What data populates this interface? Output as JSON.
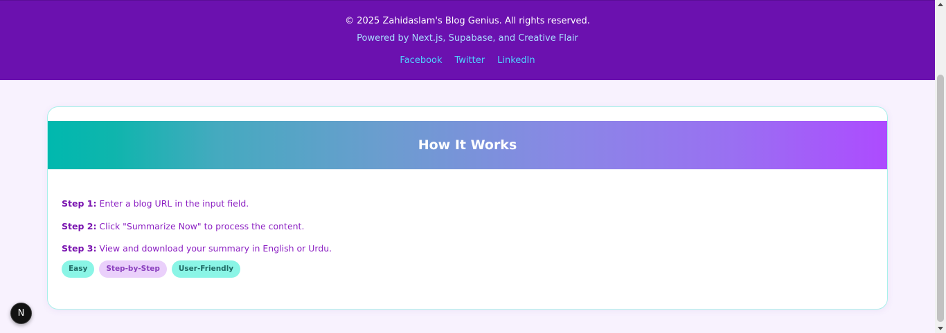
{
  "footer": {
    "copyright": "© 2025 Zahidaslam's Blog Genius. All rights reserved.",
    "powered_by": "Powered by Next.js, Supabase, and Creative Flair",
    "links": [
      "Facebook",
      "Twitter",
      "LinkedIn"
    ]
  },
  "how_it_works": {
    "title": "How It Works",
    "steps": [
      {
        "label": "Step 1:",
        "text": " Enter a blog URL in the input field."
      },
      {
        "label": "Step 2:",
        "text": " Click \"Summarize Now\" to process the content."
      },
      {
        "label": "Step 3:",
        "text": " View and download your summary in English or Urdu."
      }
    ],
    "tags": [
      "Easy",
      "Step-by-Step",
      "User-Friendly"
    ]
  },
  "dev_badge": {
    "letter": "N"
  },
  "colors": {
    "footer_bg": "#6b11af",
    "gradient_start": "#00b8ae",
    "gradient_end": "#ad4bff",
    "step_text": "#8b1fc2",
    "link": "#4fd1ff"
  }
}
